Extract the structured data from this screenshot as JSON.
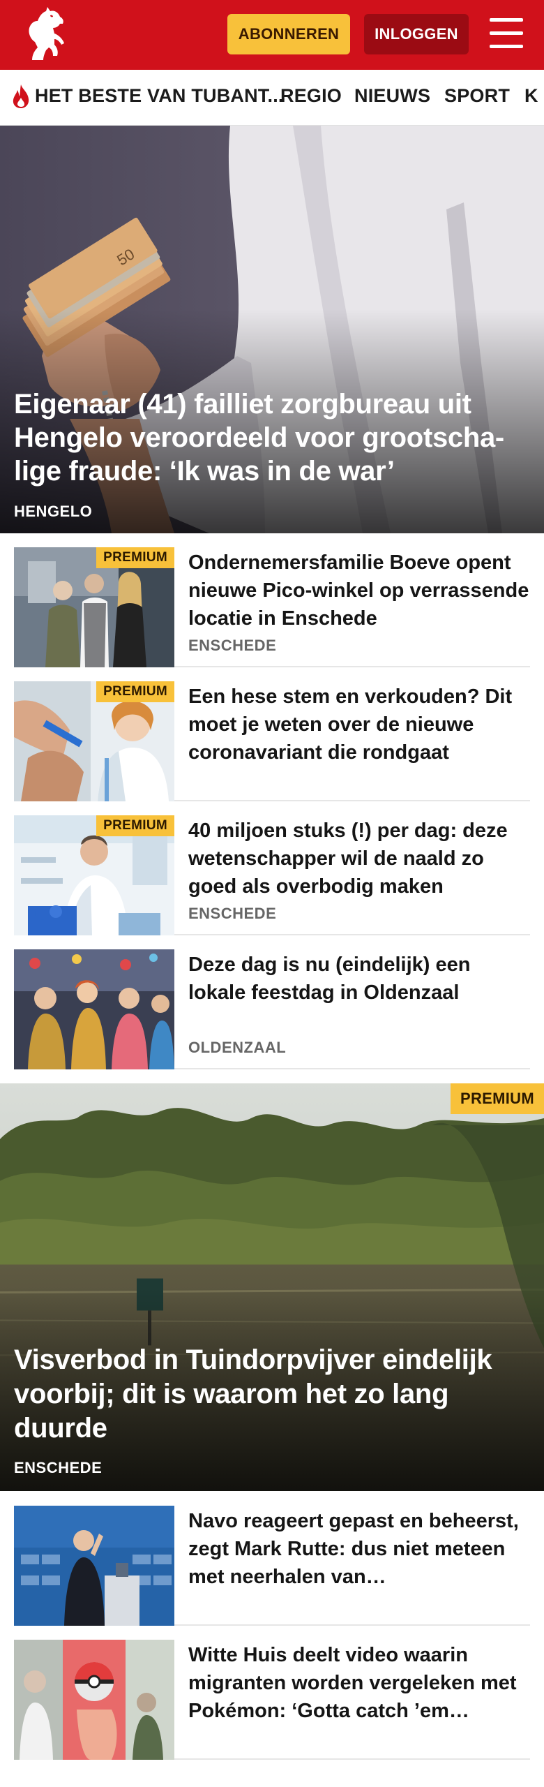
{
  "header": {
    "subscribe_label": "ABONNEREN",
    "login_label": "INLOGGEN",
    "brand_color": "#d0111b",
    "icons": {
      "logo": "horse-logo-icon",
      "menu": "hamburger-menu-icon"
    }
  },
  "nav": {
    "items": [
      {
        "label": "HET BESTE VAN TUBANT..."
      },
      {
        "label": "REGIO"
      },
      {
        "label": "NIEUWS"
      },
      {
        "label": "SPORT"
      },
      {
        "label": "K"
      }
    ],
    "flame_icon": "flame-icon"
  },
  "hero": {
    "title": "Eigenaar (41) failliet zorgbureau uit Hengelo veroordeeld voor grootscha-lige fraude: ‘Ik was in de war’",
    "location": "HENGELO"
  },
  "articles": [
    {
      "title": "Ondernemersfamilie Boeve opent nieuwe Pico-winkel op verrassende locatie in Enschede",
      "location": "ENSCHEDE",
      "badge": "PREMIUM"
    },
    {
      "title": "Een hese stem en verkouden? Dit moet je weten over de nieuwe coronavariant die rondgaat",
      "location": "",
      "badge": "PREMIUM"
    },
    {
      "title": "40 miljoen stuks (!) per dag: deze wetenschapper wil de naald zo goed als overbodig maken",
      "location": "ENSCHEDE",
      "badge": "PREMIUM"
    },
    {
      "title": "Deze dag is nu (eindelijk) een lokale feestdag in Oldenzaal",
      "location": "OLDENZAAL",
      "badge": ""
    }
  ],
  "hero2": {
    "badge": "PREMIUM",
    "title": "Visverbod in Tuindorpvijver eindelijk voorbij; dit is waarom het zo lang duurde",
    "location": "ENSCHEDE"
  },
  "articles2": [
    {
      "title": "Navo reageert gepast en beheerst, zegt Mark Rutte: dus niet meteen met neerhalen van…"
    },
    {
      "title": "Witte Huis deelt video waarin migranten worden vergeleken met Pokémon: ‘Gotta catch ’em…"
    }
  ],
  "colors": {
    "premium_badge": "#f8c13a",
    "login_button": "#9b0b13",
    "subscribe_button": "#f8c13a"
  }
}
